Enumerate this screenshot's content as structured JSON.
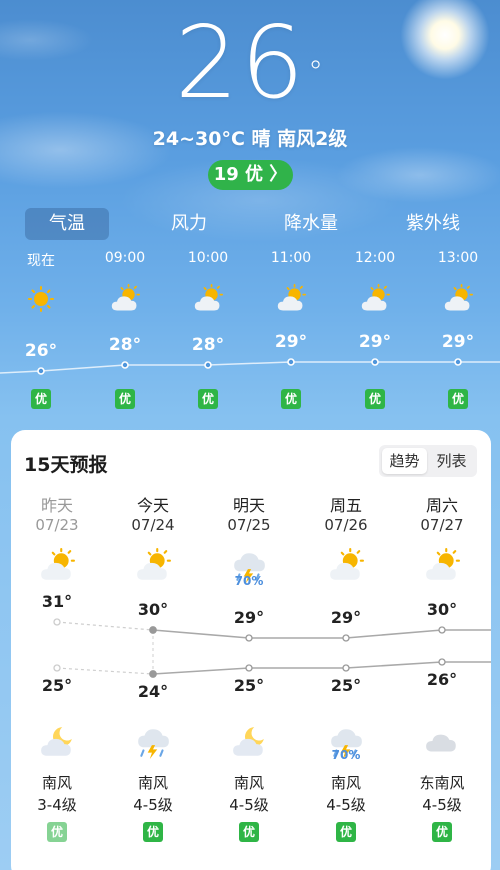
{
  "current": {
    "temp": "26",
    "deg_symbol": "°",
    "condition_line": "24~30°C 晴 南风2级",
    "aqi_label": "19 优 〉"
  },
  "tabs": [
    {
      "label": "气温",
      "active": true
    },
    {
      "label": "风力",
      "active": false
    },
    {
      "label": "降水量",
      "active": false
    },
    {
      "label": "紫外线",
      "active": false
    }
  ],
  "hourly": [
    {
      "time": "现在",
      "icon": "sunny-icon",
      "temp": "26°",
      "aqi": "优"
    },
    {
      "time": "09:00",
      "icon": "partly-cloudy-icon",
      "temp": "28°",
      "aqi": "优"
    },
    {
      "time": "10:00",
      "icon": "partly-cloudy-icon",
      "temp": "28°",
      "aqi": "优"
    },
    {
      "time": "11:00",
      "icon": "partly-cloudy-icon",
      "temp": "29°",
      "aqi": "优"
    },
    {
      "time": "12:00",
      "icon": "partly-cloudy-icon",
      "temp": "29°",
      "aqi": "优"
    },
    {
      "time": "13:00",
      "icon": "partly-cloudy-icon",
      "temp": "29°",
      "aqi": "优"
    }
  ],
  "forecast": {
    "title": "15天预报",
    "toggle": {
      "trend": "趋势",
      "list": "列表",
      "selected": "趋势"
    },
    "days": [
      {
        "name": "昨天",
        "date": "07/23",
        "day_icon": "partly-cloudy-icon",
        "precip": "",
        "high": "31°",
        "low": "25°",
        "night_icon": "moon-cloud-icon",
        "night_precip": "",
        "wind_dir": "南风",
        "wind_level": "3-4级",
        "aqi": "优",
        "past": true
      },
      {
        "name": "今天",
        "date": "07/24",
        "day_icon": "partly-cloudy-icon",
        "precip": "",
        "high": "30°",
        "low": "24°",
        "night_icon": "thunderstorm-icon",
        "night_precip": "",
        "wind_dir": "南风",
        "wind_level": "4-5级",
        "aqi": "优",
        "past": false
      },
      {
        "name": "明天",
        "date": "07/25",
        "day_icon": "thunderstorm-icon",
        "precip": "70%",
        "high": "29°",
        "low": "25°",
        "night_icon": "moon-cloud-icon",
        "night_precip": "",
        "wind_dir": "南风",
        "wind_level": "4-5级",
        "aqi": "优",
        "past": false
      },
      {
        "name": "周五",
        "date": "07/26",
        "day_icon": "partly-cloudy-icon",
        "precip": "",
        "high": "29°",
        "low": "25°",
        "night_icon": "thunderstorm-icon",
        "night_precip": "70%",
        "wind_dir": "南风",
        "wind_level": "4-5级",
        "aqi": "优",
        "past": false
      },
      {
        "name": "周六",
        "date": "07/27",
        "day_icon": "partly-cloudy-icon",
        "precip": "",
        "high": "30°",
        "low": "26°",
        "night_icon": "cloudy-icon",
        "night_precip": "",
        "wind_dir": "东南风",
        "wind_level": "4-5级",
        "aqi": "优",
        "past": false
      }
    ]
  },
  "colors": {
    "aqi_good": "#2fb546",
    "precip": "#4d8fdd",
    "sun": "#f7b500",
    "curve": "#aaaaaa"
  }
}
